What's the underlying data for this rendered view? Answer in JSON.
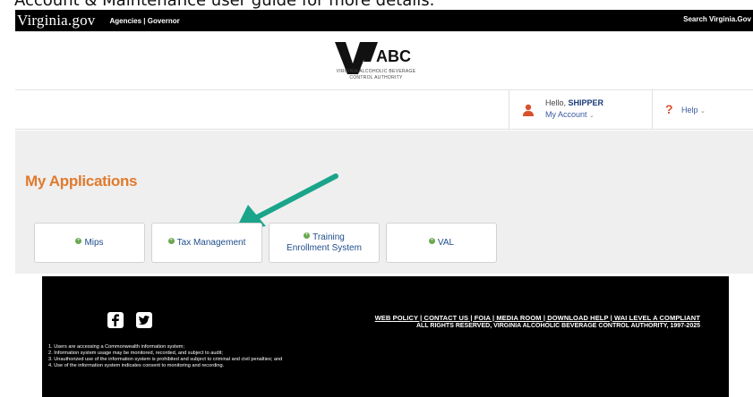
{
  "doc_caption": "Account & Maintenance user guide for more details.",
  "topbar": {
    "brand": "Virginia.gov",
    "links": "Agencies | Governor",
    "search": "Search Virginia.Gov"
  },
  "logo": {
    "name": "ABC",
    "subtitle_line1": "VIRGINIA ALCOHOLIC BEVERAGE",
    "subtitle_line2": "CONTROL AUTHORITY"
  },
  "account": {
    "hello_prefix": "Hello, ",
    "username": "SHIPPER",
    "my_account": "My Account",
    "help": "Help"
  },
  "page_title": "My Applications",
  "applications": [
    {
      "label": "Mips"
    },
    {
      "label": "Tax Management"
    },
    {
      "label": "Training Enrollment System"
    },
    {
      "label": "VAL"
    }
  ],
  "footer": {
    "links": "WEB POLICY | CONTACT US | FOIA | MEDIA ROOM | DOWNLOAD HELP | WAI LEVEL A COMPLIANT",
    "copyright": "ALL RIGHTS RESERVED, VIRGINIA ALCOHOLIC BEVERAGE CONTROL AUTHORITY, 1997-2025",
    "notices": [
      "1. Users are accessing a Commonwealth information system;",
      "2. Information system usage may be monitored, recorded, and subject to audit;",
      "3. Unauthorized use of the information system is prohibited and subject to criminal and civil penalties; and",
      "4. Use of the information system indicates consent to monitoring and recording."
    ]
  },
  "colors": {
    "accent_orange": "#e07a2e",
    "link_blue": "#1f4d8c",
    "arrow_teal": "#1aa58a",
    "app_dot_green": "#6aa84f"
  }
}
